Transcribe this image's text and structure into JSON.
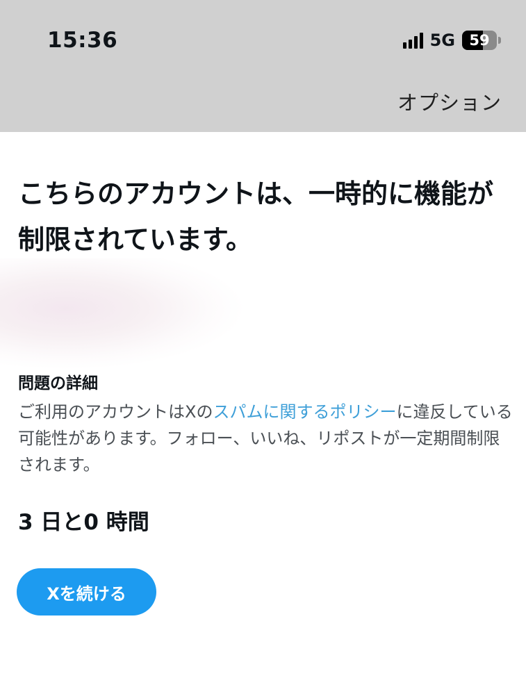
{
  "status_bar": {
    "time": "15:36",
    "network": "5G",
    "battery": "59",
    "battery_level": 0.59
  },
  "header": {
    "options_label": "オプション"
  },
  "main": {
    "headline": "こちらのアカウントは、一時的に機能が制限されています。",
    "section_title": "問題の詳細",
    "body_before_link": "ご利用のアカウントはXの",
    "policy_link": "スパムに関するポリシー",
    "body_after_link": "に違反している可能性があります。フォロー、いいね、リポストが一定期間制限されます。",
    "duration": "3 日と0 時間",
    "continue_button": "Xを続ける"
  },
  "colors": {
    "accent": "#1d9bf0",
    "link": "#3e9fd8",
    "topbar": "#d0d0d0"
  }
}
